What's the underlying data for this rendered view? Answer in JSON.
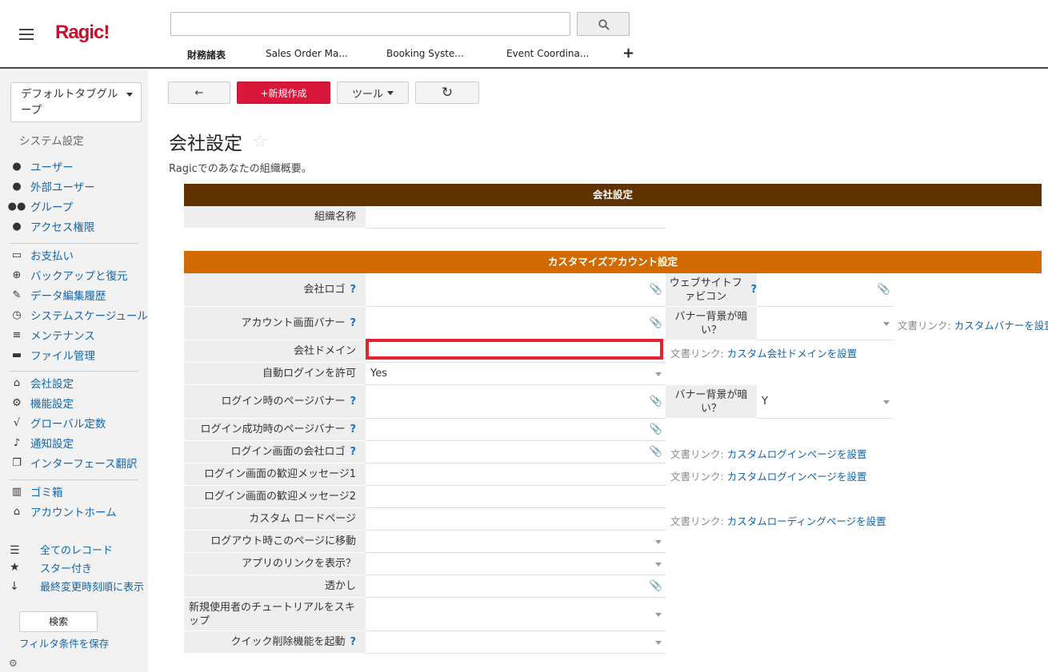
{
  "header": {
    "logo": "Ragic!",
    "search_value": "",
    "tabs": [
      "財務諸表",
      "Sales Order Ma...",
      "Booking Syste...",
      "Event Coordina..."
    ],
    "add_tab": "+"
  },
  "sidebar": {
    "tab_group": "デフォルトタブグループ",
    "section_title": "システム設定",
    "items": [
      {
        "label": "ユーザー",
        "icon": "user-icon"
      },
      {
        "label": "外部ユーザー",
        "icon": "user-icon"
      },
      {
        "label": "グループ",
        "icon": "users-icon"
      },
      {
        "label": "アクセス権限",
        "icon": "user-icon"
      },
      {
        "label": "お支払い",
        "icon": "credit-card-icon"
      },
      {
        "label": "バックアップと復元",
        "icon": "download-icon"
      },
      {
        "label": "データ編集履歴",
        "icon": "edit-icon"
      },
      {
        "label": "システムスケージュール",
        "icon": "clock-icon"
      },
      {
        "label": "メンテナンス",
        "icon": "database-icon"
      },
      {
        "label": "ファイル管理",
        "icon": "folder-icon"
      },
      {
        "label": "会社設定",
        "icon": "bank-icon"
      },
      {
        "label": "機能設定",
        "icon": "gear-icon"
      },
      {
        "label": "グローバル定数",
        "icon": "sqrt-icon"
      },
      {
        "label": "通知設定",
        "icon": "bell-icon"
      },
      {
        "label": "インターフェース翻訳",
        "icon": "copy-icon"
      },
      {
        "label": "ゴミ箱",
        "icon": "trash-icon"
      },
      {
        "label": "アカウントホーム",
        "icon": "home-icon"
      }
    ],
    "links": [
      "全てのレコード",
      "スター付き",
      "最終変更時刻順に表示"
    ],
    "search_button": "検索",
    "save_filter": "フィルタ条件を保存"
  },
  "toolbar": {
    "back": "←",
    "new": "+新規作成",
    "tools": "ツール",
    "refresh": "↻"
  },
  "page": {
    "title": "会社設定",
    "description": "Ragicでのあなたの組織概要。"
  },
  "form": {
    "section1": "会社設定",
    "org_name_label": "組織名称",
    "org_name_value": "",
    "section2": "カスタマイズアカウント設定",
    "fields": {
      "company_logo": "会社ロゴ",
      "favicon": "ウェブサイトファビコン",
      "account_banner": "アカウント画面バナー",
      "banner_dark": "バナー背景が暗い？",
      "company_domain": "会社ドメイン",
      "auto_login": "自動ログインを許可",
      "auto_login_value": "Yes",
      "login_banner": "ログイン時のページバナー",
      "banner_dark2": "バナー背景が暗い？",
      "banner_dark2_value": "Y",
      "login_success_banner": "ログイン成功時のページバナー",
      "login_logo": "ログイン画面の会社ロゴ",
      "welcome1": "ログイン画面の歓迎メッセージ1",
      "welcome2": "ログイン画面の歓迎メッセージ2",
      "custom_load": "カスタム ロードページ",
      "logout_redirect": "ログアウト時このページに移動",
      "show_app_link": "アプリのリンクを表示？",
      "watermark": "透かし",
      "skip_tutorial": "新規使用者のチュートリアルをスキップ",
      "quick_delete": "クイック削除機能を起動"
    },
    "doc_prefix": "文書リンク:",
    "doc_links": {
      "banner": "カスタムバナーを設置",
      "domain": "カスタム会社ドメインを設置",
      "login_page": "カスタムログインページを設置",
      "loading_page": "カスタムローディングページを設置"
    },
    "help": "?"
  }
}
